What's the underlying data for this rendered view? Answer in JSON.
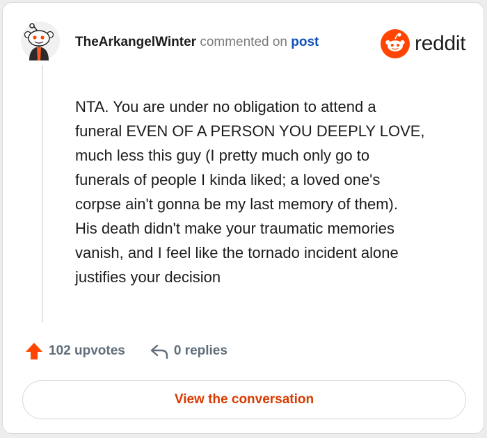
{
  "comment": {
    "username": "TheArkangelWinter",
    "action_text": "commented on",
    "target_link": "post",
    "body": "NTA. You are under no obligation to attend a\nfuneral EVEN OF A PERSON YOU DEEPLY LOVE,\nmuch less this guy (I pretty much only go to\nfunerals of people I kinda liked; a loved one's\ncorpse ain't gonna be my last memory of them).\nHis death didn't make your traumatic memories\nvanish, and I feel like the tornado incident alone\njustifies your decision"
  },
  "brand": {
    "name": "reddit",
    "color": "#ff4500"
  },
  "stats": {
    "upvotes": "102 upvotes",
    "replies": "0 replies",
    "upvote_color": "#ff4500"
  },
  "cta": {
    "label": "View the conversation",
    "color": "#d93a00"
  },
  "icons": {
    "avatar": "snoo-avatar",
    "upvote": "upvote-arrow-icon",
    "reply": "reply-arrow-icon",
    "logo": "reddit-snoo-logo"
  }
}
